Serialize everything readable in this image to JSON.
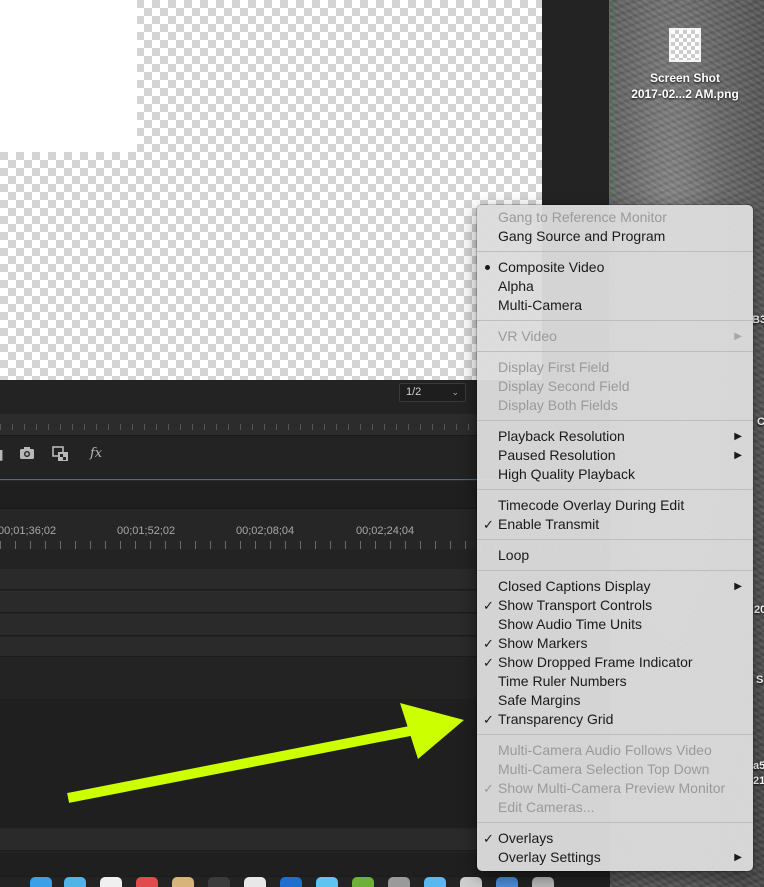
{
  "desktop": {
    "file_name_line1": "Screen Shot",
    "file_name_line2": "2017-02...2 AM.png",
    "edge_glyphs": [
      "B3",
      "C",
      "20",
      "S",
      "a5",
      "21"
    ]
  },
  "monitor": {
    "resolution_value": "1/2"
  },
  "timeline": {
    "timecodes": [
      "00;01;36;02",
      "00;01;52;02",
      "00;02;08;04",
      "00;02;24;04"
    ]
  },
  "menu": {
    "groups": [
      [
        {
          "label": "Gang to Reference Monitor",
          "enabled": false
        },
        {
          "label": "Gang Source and Program",
          "enabled": true
        }
      ],
      [
        {
          "label": "Composite Video",
          "enabled": true,
          "radio": true
        },
        {
          "label": "Alpha",
          "enabled": true
        },
        {
          "label": "Multi-Camera",
          "enabled": true
        }
      ],
      [
        {
          "label": "VR Video",
          "enabled": false,
          "submenu": true
        }
      ],
      [
        {
          "label": "Display First Field",
          "enabled": false
        },
        {
          "label": "Display Second Field",
          "enabled": false
        },
        {
          "label": "Display Both Fields",
          "enabled": false
        }
      ],
      [
        {
          "label": "Playback Resolution",
          "enabled": true,
          "submenu": true
        },
        {
          "label": "Paused Resolution",
          "enabled": true,
          "submenu": true
        },
        {
          "label": "High Quality Playback",
          "enabled": true
        }
      ],
      [
        {
          "label": "Timecode Overlay During Edit",
          "enabled": true
        },
        {
          "label": "Enable Transmit",
          "enabled": true,
          "checked": true
        }
      ],
      [
        {
          "label": "Loop",
          "enabled": true
        }
      ],
      [
        {
          "label": "Closed Captions Display",
          "enabled": true,
          "submenu": true
        },
        {
          "label": "Show Transport Controls",
          "enabled": true,
          "checked": true
        },
        {
          "label": "Show Audio Time Units",
          "enabled": true
        },
        {
          "label": "Show Markers",
          "enabled": true,
          "checked": true
        },
        {
          "label": "Show Dropped Frame Indicator",
          "enabled": true,
          "checked": true
        },
        {
          "label": "Time Ruler Numbers",
          "enabled": true
        },
        {
          "label": "Safe Margins",
          "enabled": true
        },
        {
          "label": "Transparency Grid",
          "enabled": true,
          "checked": true
        }
      ],
      [
        {
          "label": "Multi-Camera Audio Follows Video",
          "enabled": false
        },
        {
          "label": "Multi-Camera Selection Top Down",
          "enabled": false
        },
        {
          "label": "Show Multi-Camera Preview Monitor",
          "enabled": false,
          "checked": true
        },
        {
          "label": "Edit Cameras...",
          "enabled": false
        }
      ],
      [
        {
          "label": "Overlays",
          "enabled": true,
          "checked": true
        },
        {
          "label": "Overlay Settings",
          "enabled": true,
          "submenu": true
        }
      ]
    ]
  },
  "annotation": {
    "arrow_color": "#ccff00"
  },
  "colors": {
    "panel_border": "#3d6ea6",
    "menu_bg": "#dcdcdc"
  }
}
